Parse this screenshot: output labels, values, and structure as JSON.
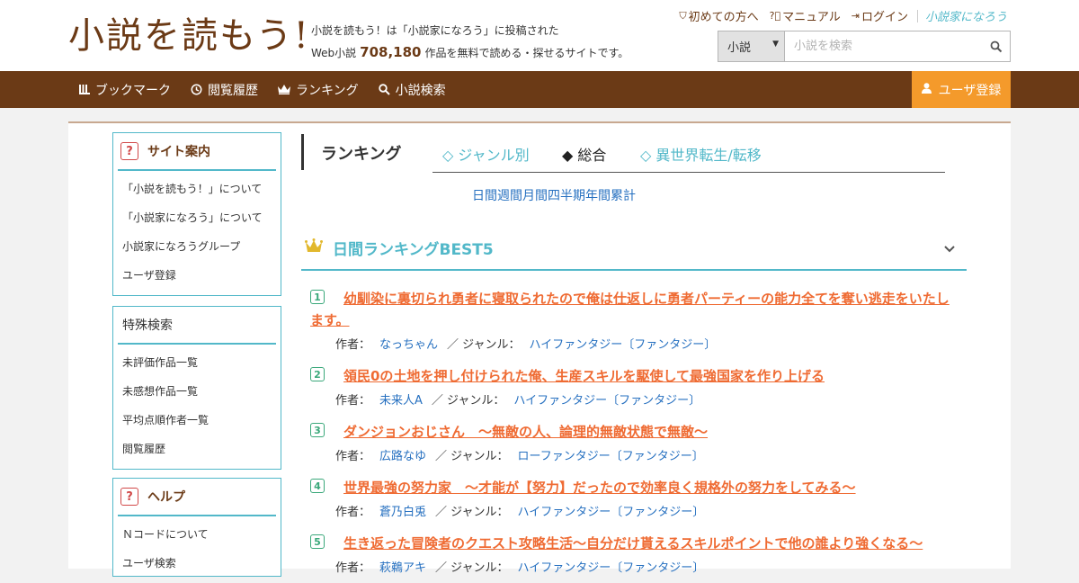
{
  "site": {
    "logo_text": "小説を読もう!",
    "tagline_1": "小説を読もう！は「小説家になろう」に投稿された",
    "tagline_2a": "Web小説",
    "work_count": "708,180",
    "tagline_2b": "作品を無料で読める・探せるサイトです。"
  },
  "toplinks": {
    "first_time": "初めての方へ",
    "manual": "マニュアル",
    "login": "ログイン",
    "narou_logo": "小説家になろう"
  },
  "search": {
    "type_selected": "小説",
    "placeholder": "小説を検索"
  },
  "nav": {
    "bookmark": "ブックマーク",
    "history": "閲覧履歴",
    "ranking": "ランキング",
    "search": "小説検索",
    "register": "ユーザ登録"
  },
  "sidebar": {
    "guide": {
      "title": "サイト案内",
      "items": [
        "「小説を読もう！」について",
        "「小説家になろう」について",
        "小説家になろうグループ",
        "ユーザ登録"
      ]
    },
    "special": {
      "title": "特殊検索",
      "items": [
        "未評価作品一覧",
        "未感想作品一覧",
        "平均点順作者一覧",
        "閲覧履歴"
      ]
    },
    "help": {
      "title": "ヘルプ",
      "items": [
        "Ｎコードについて",
        "ユーザ検索"
      ]
    }
  },
  "ranking_tabs": {
    "title": "ランキング",
    "genre": "◇ ジャンル別",
    "overall": "◆ 総合",
    "isekai": "◇ 異世界転生/転移"
  },
  "periods": [
    "日間",
    "週間",
    "月間",
    "四半期",
    "年間",
    "累計"
  ],
  "section_title": "日間ランキングBEST5",
  "labels": {
    "author": "作者：",
    "genre": "／ ジャンル："
  },
  "rankings": [
    {
      "num": "1",
      "title": "幼馴染に裏切られ勇者に寝取られたので俺は仕返しに勇者パーティーの能力全てを奪い逃走をいたします。",
      "author": "なっちゃん",
      "genre": "ハイファンタジー〔ファンタジー〕"
    },
    {
      "num": "2",
      "title": "領民0の土地を押し付けられた俺、生産スキルを駆使して最強国家を作り上げる",
      "author": "未来人A",
      "genre": "ハイファンタジー〔ファンタジー〕"
    },
    {
      "num": "3",
      "title": "ダンジョンおじさん　～無敵の人、論理的無敵状態で無敵～",
      "author": "広路なゆ",
      "genre": "ローファンタジー〔ファンタジー〕"
    },
    {
      "num": "4",
      "title": "世界最強の努力家　～才能が【努力】だったので効率良く規格外の努力をしてみる～",
      "author": "蒼乃白兎",
      "genre": "ハイファンタジー〔ファンタジー〕"
    },
    {
      "num": "5",
      "title": "生き返った冒険者のクエスト攻略生活～自分だけ貰えるスキルポイントで他の誰より強くなる～",
      "author": "萩鵜アキ",
      "genre": "ハイファンタジー〔ファンタジー〕"
    }
  ]
}
